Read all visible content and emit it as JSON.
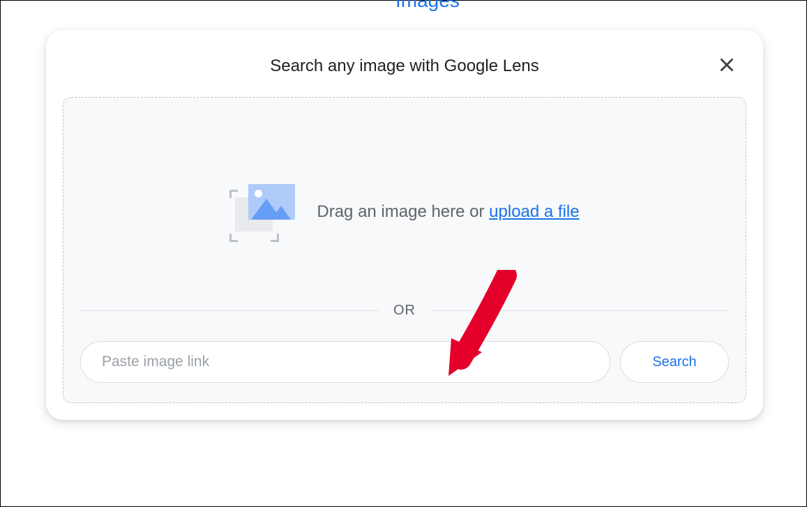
{
  "partial_link_text": "Images",
  "modal": {
    "title": "Search any image with Google Lens",
    "drag_text": "Drag an image here or ",
    "upload_link": "upload a file",
    "divider": "OR",
    "input_placeholder": "Paste image link",
    "search_button": "Search"
  },
  "colors": {
    "accent": "#1a73e8",
    "text_muted": "#5f6368",
    "bg_drop": "#f8f9fa"
  }
}
